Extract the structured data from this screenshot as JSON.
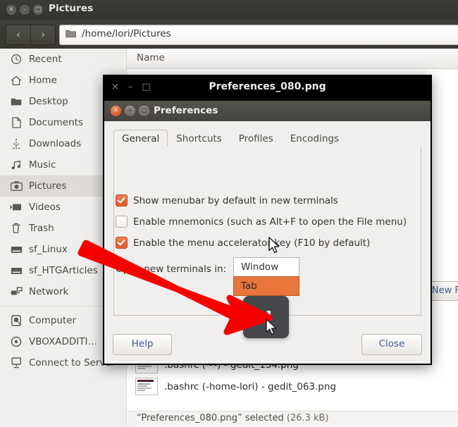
{
  "file_manager": {
    "window_title": "Pictures",
    "window_buttons": [
      "close",
      "minimize",
      "maximize"
    ],
    "nav": {
      "back": "‹",
      "forward": "›"
    },
    "path": "/home/lori/Pictures",
    "sidebar": {
      "items": [
        {
          "label": "Recent",
          "icon": "clock-icon"
        },
        {
          "label": "Home",
          "icon": "home-icon"
        },
        {
          "label": "Desktop",
          "icon": "folder-icon"
        },
        {
          "label": "Documents",
          "icon": "document-icon"
        },
        {
          "label": "Downloads",
          "icon": "download-icon"
        },
        {
          "label": "Music",
          "icon": "music-icon"
        },
        {
          "label": "Pictures",
          "icon": "camera-icon",
          "selected": true
        },
        {
          "label": "Videos",
          "icon": "video-icon"
        },
        {
          "label": "Trash",
          "icon": "trash-icon"
        },
        {
          "label": "sf_Linux",
          "icon": "drive-icon"
        },
        {
          "label": "sf_HTGArticles",
          "icon": "drive-icon"
        },
        {
          "label": "Network",
          "icon": "network-icon"
        }
      ],
      "items2": [
        {
          "label": "Computer",
          "icon": "computer-disk-icon"
        },
        {
          "label": "VBOXADDITI…",
          "icon": "disc-icon"
        },
        {
          "label": "Connect to Server",
          "icon": "server-icon"
        }
      ]
    },
    "column_header": "Name",
    "files": [
      {
        "name": ".bashrc (~-) - gedit_154.png"
      },
      {
        "name": ".bashrc (-home-lori) - gedit_063.png"
      }
    ],
    "new_file_button": "New Fil",
    "status": "“Preferences_080.png” selected",
    "status_size": "(26.3 kB)"
  },
  "viewer": {
    "title": "Preferences_080.png",
    "buttons": {
      "close": "×",
      "minimize": "–",
      "maximize": "□"
    },
    "fullscreen_button_icon": "expand-arrows-icon"
  },
  "preferences": {
    "title": "Preferences",
    "window_buttons": {
      "close": "×",
      "minimize": "–",
      "maximize": "□"
    },
    "tabs": [
      {
        "label": "General",
        "active": true
      },
      {
        "label": "Shortcuts",
        "active": false
      },
      {
        "label": "Profiles",
        "active": false
      },
      {
        "label": "Encodings",
        "active": false
      }
    ],
    "checkboxes": [
      {
        "label": "Show menubar by default in new terminals",
        "checked": true
      },
      {
        "label": "Enable mnemonics (such as Alt+F to open the File menu)",
        "checked": false
      },
      {
        "label": "Enable the menu accelerator key (F10 by default)",
        "checked": true
      }
    ],
    "combo": {
      "label": "Open new terminals in:",
      "options": [
        "Window",
        "Tab"
      ],
      "highlighted": "Tab"
    },
    "footer": {
      "help": "Help",
      "close": "Close"
    }
  },
  "annotation": {
    "arrow_color": "#f60000"
  },
  "colors": {
    "accent_orange": "#e8763c",
    "checkbox_orange": "#df5626",
    "link_blue": "#3f5e8c",
    "titlebar_dark": "#3c3b37"
  }
}
